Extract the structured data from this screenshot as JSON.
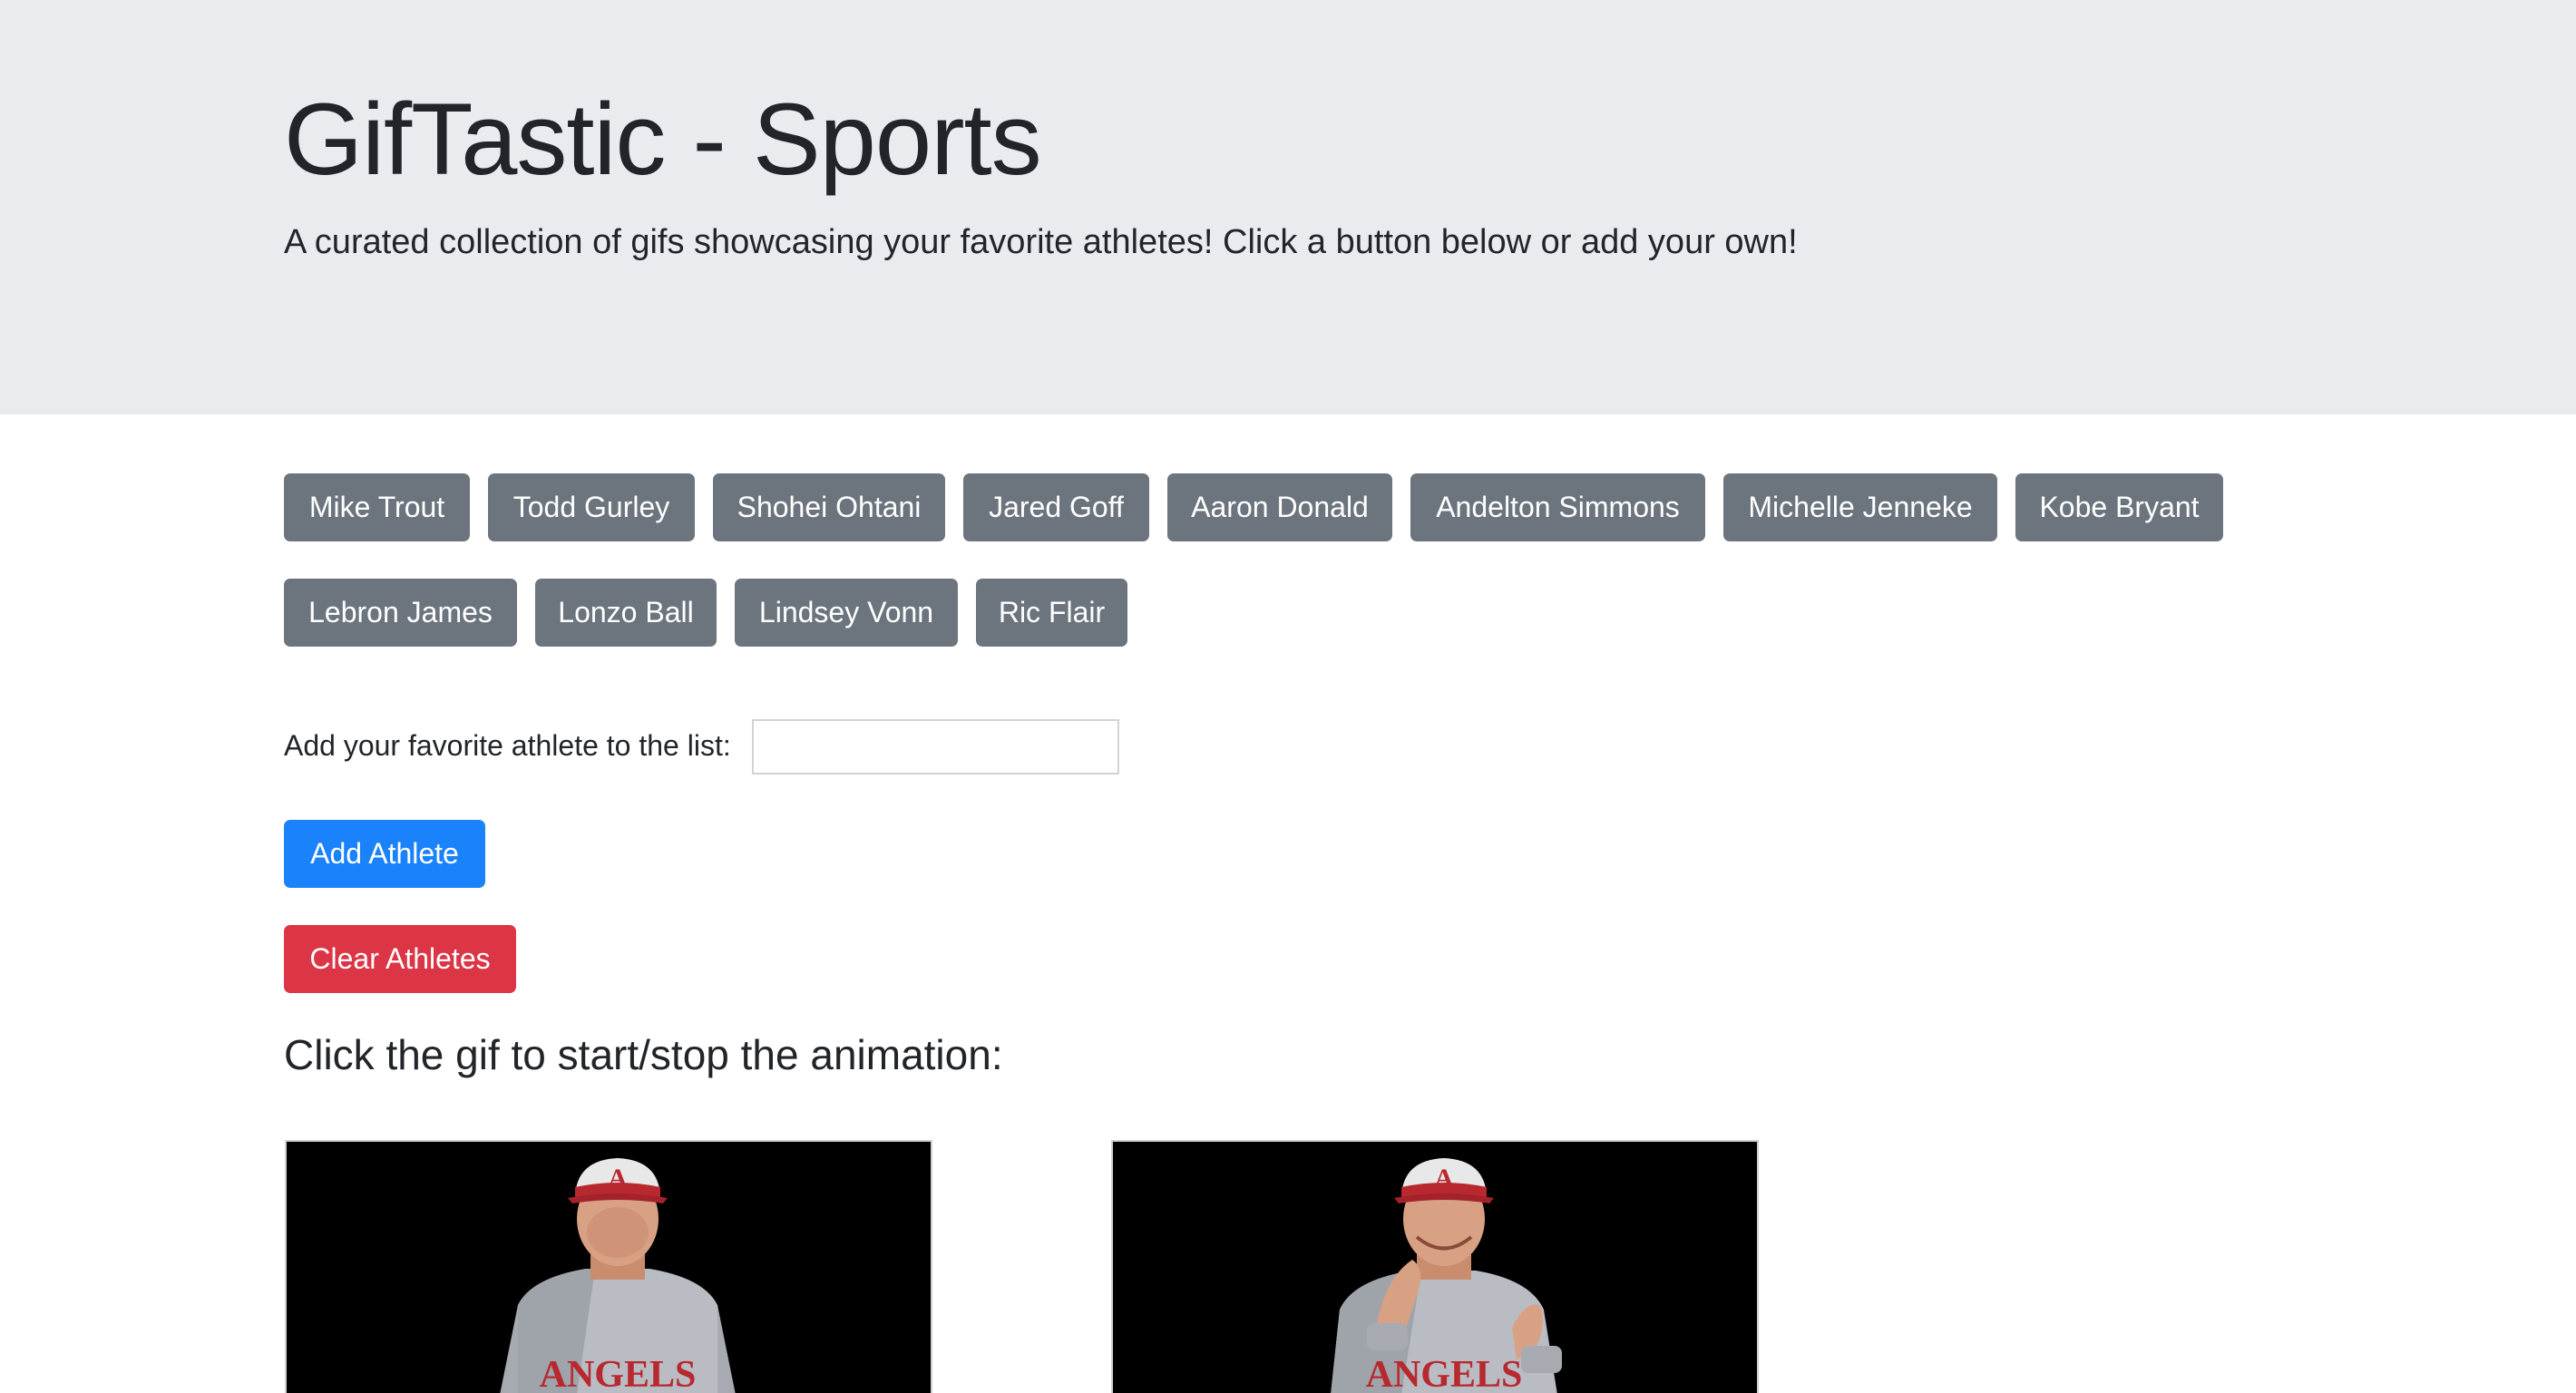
{
  "header": {
    "title": "GifTastic - Sports",
    "lead": "A curated collection of gifs showcasing your favorite athletes! Click a button below or add your own!"
  },
  "athletes": [
    "Mike Trout",
    "Todd Gurley",
    "Shohei Ohtani",
    "Jared Goff",
    "Aaron Donald",
    "Andelton Simmons",
    "Michelle Jenneke",
    "Kobe Bryant",
    "Lebron James",
    "Lonzo Ball",
    "Lindsey Vonn",
    "Ric Flair"
  ],
  "form": {
    "label": "Add your favorite athlete to the list:",
    "input_value": "",
    "add_label": "Add Athlete",
    "clear_label": "Clear Athletes"
  },
  "results": {
    "instructions": "Click the gif to start/stop the animation:",
    "gifs": [
      {
        "jersey_text": "ANGELS",
        "cap_letter": "A",
        "state": "still"
      },
      {
        "jersey_text": "ANGELS",
        "cap_letter": "A",
        "state": "clapping"
      }
    ]
  },
  "colors": {
    "jumbotron": "#e9ecef",
    "secondary": "#6c757d",
    "primary": "#1a82fb",
    "danger": "#dc3545"
  }
}
